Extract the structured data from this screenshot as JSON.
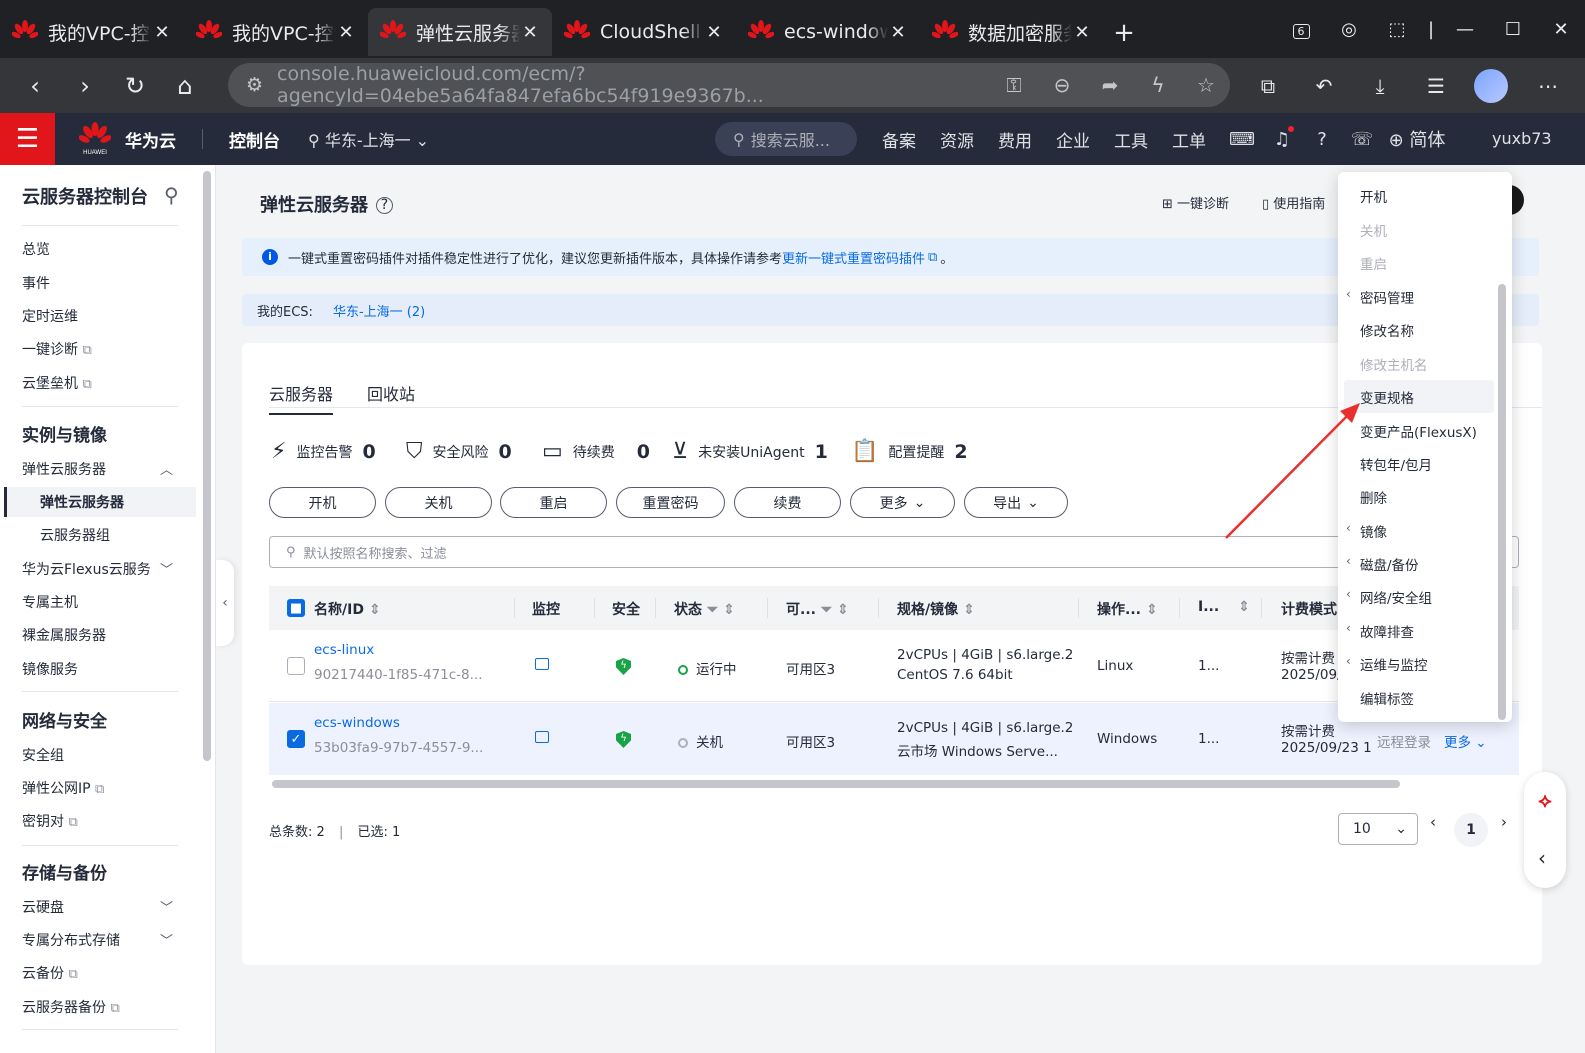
{
  "browser": {
    "tabs": [
      {
        "title": "我的VPC-控制台",
        "active": false
      },
      {
        "title": "我的VPC-控制台",
        "active": false
      },
      {
        "title": "弹性云服务器",
        "active": true
      },
      {
        "title": "CloudShell",
        "active": false
      },
      {
        "title": "ecs-windows",
        "active": false
      },
      {
        "title": "数据加密服务",
        "active": false
      }
    ],
    "tab_count_badge": "6",
    "url": "console.huaweicloud.com/ecm/?agencyId=04ebe5a64fa847efa6bc54f919e9367b..."
  },
  "header": {
    "brand": "华为云",
    "logo_text": "HUAWEI",
    "console": "控制台",
    "region": "华东-上海一",
    "search_placeholder": "搜索云服...",
    "nav": [
      "备案",
      "资源",
      "费用",
      "企业",
      "工具",
      "工单"
    ],
    "lang": "简体",
    "user": "yuxb73"
  },
  "sidebar": {
    "title": "云服务器控制台",
    "items_top": [
      {
        "label": "总览"
      },
      {
        "label": "事件"
      },
      {
        "label": "定时运维"
      },
      {
        "label": "一键诊断"
      },
      {
        "label": "云堡垒机"
      }
    ],
    "section_instances": "实例与镜像",
    "instances": [
      {
        "label": "弹性云服务器"
      },
      {
        "label": "弹性云服务器"
      },
      {
        "label": "云服务器组"
      },
      {
        "label": "华为云Flexus云服务"
      },
      {
        "label": "专属主机"
      },
      {
        "label": "裸金属服务器"
      },
      {
        "label": "镜像服务"
      }
    ],
    "section_network": "网络与安全",
    "network": [
      {
        "label": "安全组"
      },
      {
        "label": "弹性公网IP"
      },
      {
        "label": "密钥对"
      }
    ],
    "section_storage": "存储与备份",
    "storage": [
      {
        "label": "云硬盘"
      },
      {
        "label": "专属分布式存储"
      },
      {
        "label": "云备份"
      },
      {
        "label": "云服务器备份"
      }
    ]
  },
  "page": {
    "title": "弹性云服务器",
    "actions": [
      "一键诊断",
      "使用指南"
    ],
    "notice_text": "一键式重置密码插件对插件稳定性进行了优化，建议您更新插件版本，具体操作请参考",
    "notice_link": "更新一键式重置密码插件",
    "notice_end": "。",
    "my_ecs_label": "我的ECS:",
    "my_ecs_region": "华东-上海一 (2)",
    "tabs": [
      "云服务器",
      "回收站"
    ],
    "stats": [
      {
        "label": "监控告警",
        "value": "0"
      },
      {
        "label": "安全风险",
        "value": "0"
      },
      {
        "label": "待续费",
        "value": "0"
      },
      {
        "label": "未安装UniAgent",
        "value": "1"
      },
      {
        "label": "配置提醒",
        "value": "2"
      }
    ],
    "buttons": [
      "开机",
      "关机",
      "重启",
      "重置密码",
      "续费",
      "更多",
      "导出"
    ],
    "filter_placeholder": "默认按照名称搜索、过滤",
    "columns": [
      "名称/ID",
      "监控",
      "安全",
      "状态",
      "可...",
      "规格/镜像",
      "操作...",
      "I...",
      "计费模式"
    ],
    "rows": [
      {
        "name": "ecs-linux",
        "id": "90217440-1f85-471c-8...",
        "status": "运行中",
        "az": "可用区3",
        "spec": "2vCPUs | 4GiB | s6.large.2",
        "image": "CentOS 7.6 64bit",
        "os": "Linux",
        "ip": "1...",
        "billing": "按需计费",
        "date": "2025/09/2",
        "checked": false
      },
      {
        "name": "ecs-windows",
        "id": "53b03fa9-97b7-4557-9...",
        "status": "关机",
        "az": "可用区3",
        "spec": "2vCPUs | 4GiB | s6.large.2",
        "image": "云市场  Windows Serve...",
        "os": "Windows",
        "ip": "1...",
        "billing": "按需计费",
        "date": "2025/09/23 1",
        "remote": "远程登录",
        "more": "更多",
        "checked": true
      }
    ],
    "total_label": "总条数:",
    "total": "2",
    "selected_label": "已选:",
    "selected": "1",
    "page_size": "10",
    "current_page": "1"
  },
  "dropdown": {
    "items": [
      {
        "label": "开机",
        "disabled": false,
        "submenu": false
      },
      {
        "label": "关机",
        "disabled": true,
        "submenu": false
      },
      {
        "label": "重启",
        "disabled": true,
        "submenu": false
      },
      {
        "label": "密码管理",
        "disabled": false,
        "submenu": true
      },
      {
        "label": "修改名称",
        "disabled": false,
        "submenu": false
      },
      {
        "label": "修改主机名",
        "disabled": true,
        "submenu": false
      },
      {
        "label": "变更规格",
        "disabled": false,
        "submenu": false
      },
      {
        "label": "变更产品(FlexusX)",
        "disabled": false,
        "submenu": false
      },
      {
        "label": "转包年/包月",
        "disabled": false,
        "submenu": false
      },
      {
        "label": "删除",
        "disabled": false,
        "submenu": false
      },
      {
        "label": "镜像",
        "disabled": false,
        "submenu": true
      },
      {
        "label": "磁盘/备份",
        "disabled": false,
        "submenu": true
      },
      {
        "label": "网络/安全组",
        "disabled": false,
        "submenu": true
      },
      {
        "label": "故障排查",
        "disabled": false,
        "submenu": true
      },
      {
        "label": "运维与监控",
        "disabled": false,
        "submenu": true
      },
      {
        "label": "编辑标签",
        "disabled": false,
        "submenu": false
      }
    ],
    "highlighted": "变更规格"
  },
  "colors": {
    "brand_red": "#e0161b",
    "header_bg": "#252b3a",
    "link": "#0a6be1",
    "annotation_arrow": "#e8312f"
  }
}
